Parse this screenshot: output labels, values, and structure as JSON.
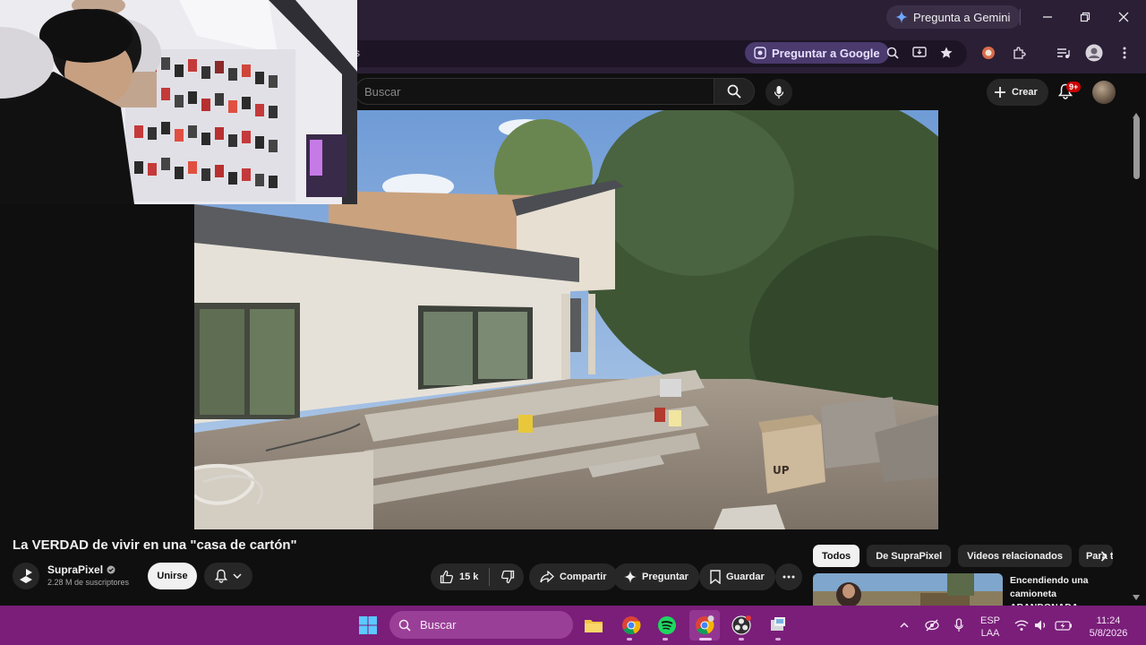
{
  "browser": {
    "gemini_button": "Pregunta a Gemini",
    "ask_google": "Preguntar a Google",
    "url_fragment": "s"
  },
  "youtube": {
    "search_placeholder": "Buscar",
    "create_label": "Crear",
    "notifications_badge": "9+"
  },
  "video": {
    "title": "La VERDAD de vivir en una \"casa de cartón\"",
    "channel": {
      "name": "SupraPixel",
      "subscribers": "2.28 M de suscriptores",
      "join_label": "Unirse"
    },
    "actions": {
      "likes": "15 k",
      "share": "Compartir",
      "ask": "Preguntar",
      "save": "Guardar"
    },
    "scene_sign": "UP"
  },
  "recommendations": {
    "chips": [
      "Todos",
      "De SupraPixel",
      "Videos relacionados",
      "Para ti"
    ],
    "first": {
      "title": "Encendiendo una camioneta ABANDONADA"
    }
  },
  "taskbar": {
    "search_label": "Buscar",
    "language": "ESP",
    "layout": "LAA",
    "time": "11:24",
    "date": "5/8/2026"
  },
  "colors": {
    "taskbar": "#7a1e7a",
    "browser_frame": "#2a1f35",
    "youtube_bg": "#0f0f0f",
    "badge_red": "#cc0000"
  }
}
